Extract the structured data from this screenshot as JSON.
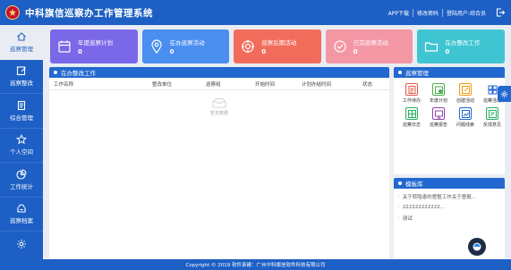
{
  "header": {
    "title": "中科旗信巡察办工作管理系统",
    "links": [
      "APP下载",
      "修改密码",
      "登陆用户:综合员"
    ]
  },
  "sidebar": {
    "items": [
      {
        "label": "巡察管理",
        "icon": "home-icon"
      },
      {
        "label": "巡察整改",
        "icon": "edit-icon"
      },
      {
        "label": "综合管理",
        "icon": "document-icon"
      },
      {
        "label": "个人空间",
        "icon": "star-icon"
      },
      {
        "label": "工作统计",
        "icon": "pie-chart-icon"
      },
      {
        "label": "巡察档案",
        "icon": "archive-icon"
      }
    ]
  },
  "cards": [
    {
      "label": "年度巡察计划",
      "value": "0",
      "color": "#7b68e8",
      "icon": "calendar-icon"
    },
    {
      "label": "在办巡察活动",
      "value": "0",
      "color": "#4a8ef0",
      "icon": "location-icon"
    },
    {
      "label": "巡察后期活动",
      "value": "0",
      "color": "#f26c5c",
      "icon": "target-icon"
    },
    {
      "label": "已完巡察活动",
      "value": "0",
      "color": "#f497a5",
      "icon": "check-circle-icon"
    },
    {
      "label": "在办整改工作",
      "value": "0",
      "color": "#3fc5d1",
      "icon": "folder-icon"
    }
  ],
  "rectification": {
    "title": "在办整改工作",
    "columns": [
      "工作名称",
      "整改单位",
      "巡察组",
      "开始时间",
      "计划办结时间",
      "状态"
    ],
    "empty_text": "暂无数据"
  },
  "tools": {
    "title": "巡察管理",
    "items": [
      {
        "label": "工作待办",
        "icon": "todo-icon",
        "color": "#e8564a"
      },
      {
        "label": "年度计划",
        "icon": "calendar-plan-icon",
        "color": "#4caf50"
      },
      {
        "label": "创建活动",
        "icon": "create-icon",
        "color": "#f39c12"
      },
      {
        "label": "巡察活动",
        "icon": "activity-icon",
        "color": "#2268d0"
      },
      {
        "label": "巡察日志",
        "icon": "log-icon",
        "color": "#27ae60"
      },
      {
        "label": "巡察报告",
        "icon": "report-icon",
        "color": "#8e44ad"
      },
      {
        "label": "问题线索",
        "icon": "clue-icon",
        "color": "#2268d0"
      },
      {
        "label": "反馈意见",
        "icon": "feedback-icon",
        "color": "#27ae60"
      }
    ]
  },
  "templates": {
    "title": "模板库",
    "items": [
      "关于转隐患的督整工作关于督报...",
      "222222222222...",
      "测试"
    ]
  },
  "footer": {
    "text": "Copyright © 2019 软件承建：广州中科旗信软件科技有限公司"
  }
}
